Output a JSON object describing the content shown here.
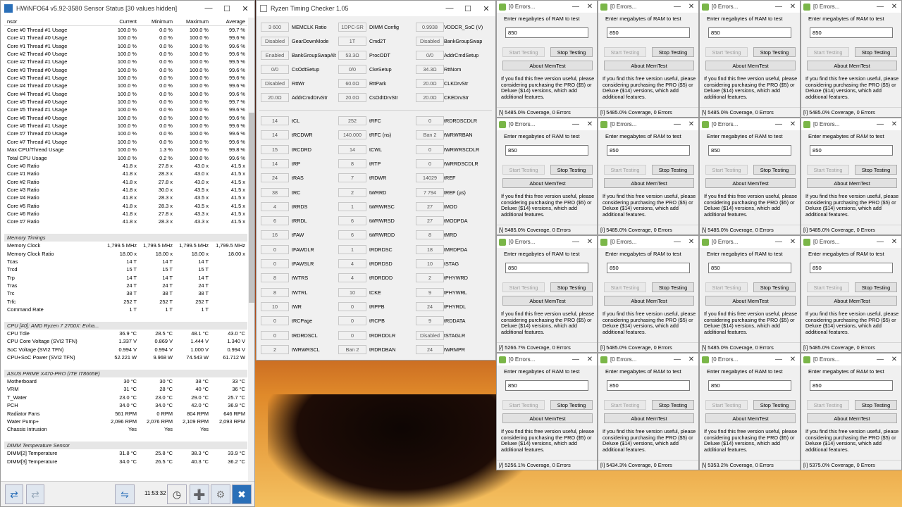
{
  "hwinfo": {
    "title": "HWiNFO64 v5.92-3580 Sensor Status [30 values hidden]",
    "columns": [
      "nsor",
      "Current",
      "Minimum",
      "Maximum",
      "Average"
    ],
    "rows": [
      [
        "Core #0 Thread #1 Usage",
        "100.0 %",
        "0.0 %",
        "100.0 %",
        "99.7 %"
      ],
      [
        "Core #1 Thread #0 Usage",
        "100.0 %",
        "0.0 %",
        "100.0 %",
        "99.6 %"
      ],
      [
        "Core #1 Thread #1 Usage",
        "100.0 %",
        "0.0 %",
        "100.0 %",
        "99.6 %"
      ],
      [
        "Core #2 Thread #0 Usage",
        "100.0 %",
        "0.0 %",
        "100.0 %",
        "99.6 %"
      ],
      [
        "Core #2 Thread #1 Usage",
        "100.0 %",
        "0.0 %",
        "100.0 %",
        "99.5 %"
      ],
      [
        "Core #3 Thread #0 Usage",
        "100.0 %",
        "0.0 %",
        "100.0 %",
        "99.6 %"
      ],
      [
        "Core #3 Thread #1 Usage",
        "100.0 %",
        "0.0 %",
        "100.0 %",
        "99.6 %"
      ],
      [
        "Core #4 Thread #0 Usage",
        "100.0 %",
        "0.0 %",
        "100.0 %",
        "99.6 %"
      ],
      [
        "Core #4 Thread #1 Usage",
        "100.0 %",
        "0.0 %",
        "100.0 %",
        "99.6 %"
      ],
      [
        "Core #5 Thread #0 Usage",
        "100.0 %",
        "0.0 %",
        "100.0 %",
        "99.7 %"
      ],
      [
        "Core #5 Thread #1 Usage",
        "100.0 %",
        "0.0 %",
        "100.0 %",
        "99.6 %"
      ],
      [
        "Core #6 Thread #0 Usage",
        "100.0 %",
        "0.0 %",
        "100.0 %",
        "99.6 %"
      ],
      [
        "Core #6 Thread #1 Usage",
        "100.0 %",
        "0.0 %",
        "100.0 %",
        "99.6 %"
      ],
      [
        "Core #7 Thread #0 Usage",
        "100.0 %",
        "0.0 %",
        "100.0 %",
        "99.6 %"
      ],
      [
        "Core #7 Thread #1 Usage",
        "100.0 %",
        "0.0 %",
        "100.0 %",
        "99.6 %"
      ],
      [
        "Max CPU/Thread Usage",
        "100.0 %",
        "1.3 %",
        "100.0 %",
        "99.8 %"
      ],
      [
        "Total CPU Usage",
        "100.0 %",
        "0.2 %",
        "100.0 %",
        "99.6 %"
      ],
      [
        "Core #0 Ratio",
        "41.8 x",
        "27.8 x",
        "43.0 x",
        "41.5 x"
      ],
      [
        "Core #1 Ratio",
        "41.8 x",
        "28.3 x",
        "43.0 x",
        "41.5 x"
      ],
      [
        "Core #2 Ratio",
        "41.8 x",
        "27.8 x",
        "43.0 x",
        "41.5 x"
      ],
      [
        "Core #3 Ratio",
        "41.8 x",
        "30.0 x",
        "43.5 x",
        "41.5 x"
      ],
      [
        "Core #4 Ratio",
        "41.8 x",
        "28.3 x",
        "43.5 x",
        "41.5 x"
      ],
      [
        "Core #5 Ratio",
        "41.8 x",
        "28.3 x",
        "43.5 x",
        "41.5 x"
      ],
      [
        "Core #6 Ratio",
        "41.8 x",
        "27.8 x",
        "43.3 x",
        "41.5 x"
      ],
      [
        "Core #7 Ratio",
        "41.8 x",
        "28.3 x",
        "43.3 x",
        "41.5 x"
      ],
      {
        "blank": true
      },
      {
        "section": "Memory Timings"
      },
      [
        "Memory Clock",
        "1,799.5 MHz",
        "1,799.5 MHz",
        "1,799.5 MHz",
        "1,799.5 MHz"
      ],
      [
        "Memory Clock Ratio",
        "18.00 x",
        "18.00 x",
        "18.00 x",
        "18.00 x"
      ],
      [
        "Tcas",
        "14 T",
        "14 T",
        "14 T",
        ""
      ],
      [
        "Trcd",
        "15 T",
        "15 T",
        "15 T",
        ""
      ],
      [
        "Trp",
        "14 T",
        "14 T",
        "14 T",
        ""
      ],
      [
        "Tras",
        "24 T",
        "24 T",
        "24 T",
        ""
      ],
      [
        "Trc",
        "38 T",
        "38 T",
        "38 T",
        ""
      ],
      [
        "Trfc",
        "252 T",
        "252 T",
        "252 T",
        ""
      ],
      [
        "Command Rate",
        "1 T",
        "1 T",
        "1 T",
        ""
      ],
      {
        "blank": true
      },
      {
        "section": "CPU [#0]: AMD Ryzen 7 2700X: Enha..."
      },
      [
        "CPU Tdie",
        "36.9 °C",
        "28.5 °C",
        "48.1 °C",
        "43.0 °C"
      ],
      [
        "CPU Core Voltage (SVI2 TFN)",
        "1.337 V",
        "0.869 V",
        "1.444 V",
        "1.340 V"
      ],
      [
        "SoC Voltage (SVI2 TFN)",
        "0.994 V",
        "0.994 V",
        "1.000 V",
        "0.994 V"
      ],
      [
        "CPU+SoC Power (SVI2 TFN)",
        "52.221 W",
        "9.968 W",
        "74.543 W",
        "61.712 W"
      ],
      {
        "blank": true
      },
      {
        "section": "ASUS PRIME X470-PRO (ITE IT8665E)"
      },
      [
        "Motherboard",
        "30 °C",
        "30 °C",
        "38 °C",
        "33 °C"
      ],
      [
        "VRM",
        "31 °C",
        "28 °C",
        "40 °C",
        "36 °C"
      ],
      [
        "T_Water",
        "23.0 °C",
        "23.0 °C",
        "29.0 °C",
        "25.7 °C"
      ],
      [
        "PCH",
        "34.0 °C",
        "34.0 °C",
        "42.0 °C",
        "36.9 °C"
      ],
      [
        "Radiator Fans",
        "561 RPM",
        "0 RPM",
        "804 RPM",
        "646 RPM"
      ],
      [
        "Water Pump+",
        "2,096 RPM",
        "2,076 RPM",
        "2,109 RPM",
        "2,093 RPM"
      ],
      [
        "Chassis Intrusion",
        "Yes",
        "Yes",
        "Yes",
        ""
      ],
      {
        "blank": true
      },
      {
        "section": "DIMM Temperature Sensor"
      },
      [
        "DIMM[2] Temperature",
        "31.8 °C",
        "25.8 °C",
        "38.3 °C",
        "33.9 °C"
      ],
      [
        "DIMM[3] Temperature",
        "34.0 °C",
        "26.5 °C",
        "40.3 °C",
        "36.2 °C"
      ]
    ],
    "time": "11:53:32"
  },
  "rtc": {
    "title": "Ryzen Timing Checker 1.05",
    "top": [
      [
        [
          "3 600",
          "MEMCLK Ratio"
        ],
        [
          "1DPC-SR",
          "DIMM Config"
        ],
        [
          "0.9938",
          "VDDCR_SoC (V)"
        ]
      ],
      [
        [
          "Disabled",
          "GearDownMode"
        ],
        [
          "1T",
          "Cmd2T"
        ],
        [
          "Disabled",
          "BankGroupSwap"
        ]
      ],
      [
        [
          "Enabled",
          "BankGroupSwapAlt"
        ],
        [
          "53.3Ω",
          "ProcODT"
        ],
        [
          "0/0",
          "AddrCmdSetup"
        ]
      ],
      [
        [
          "0/0",
          "CsOdtSetup"
        ],
        [
          "0/0",
          "CkeSetup"
        ],
        [
          "34.3Ω",
          "RttNom"
        ]
      ],
      [
        [
          "Disabled",
          "RttWr"
        ],
        [
          "60.0Ω",
          "RttPark"
        ],
        [
          "20.0Ω",
          "CLKDrvStr"
        ]
      ],
      [
        [
          "20.0Ω",
          "AddrCmdDrvStr"
        ],
        [
          "20.0Ω",
          "CsOdtDrvStr"
        ],
        [
          "20.0Ω",
          "CKEDrvStr"
        ]
      ]
    ],
    "timings": [
      [
        [
          "14",
          "tCL"
        ],
        [
          "252",
          "tRFC"
        ],
        [
          "0",
          "tRDRDSCDLR"
        ]
      ],
      [
        [
          "14",
          "tRCDWR"
        ],
        [
          "140.000",
          "tRFC (ns)"
        ],
        [
          "Ban 2",
          "tWRWRBAN"
        ]
      ],
      [
        [
          "15",
          "tRCDRD"
        ],
        [
          "14",
          "tCWL"
        ],
        [
          "0",
          "tWRWRSCDLR"
        ]
      ],
      [
        [
          "14",
          "tRP"
        ],
        [
          "8",
          "tRTP"
        ],
        [
          "0",
          "tWRRDSCDLR"
        ]
      ],
      [
        [
          "24",
          "tRAS"
        ],
        [
          "7",
          "tRDWR"
        ],
        [
          "14029",
          "tREF"
        ]
      ],
      [
        [
          "38",
          "tRC"
        ],
        [
          "2",
          "tWRRD"
        ],
        [
          "7 794",
          "tREF (µs)"
        ]
      ],
      [
        [
          "4",
          "tRRDS"
        ],
        [
          "1",
          "tWRWRSC"
        ],
        [
          "27",
          "tMOD"
        ]
      ],
      [
        [
          "6",
          "tRRDL"
        ],
        [
          "6",
          "tWRWRSD"
        ],
        [
          "27",
          "tMODPDA"
        ]
      ],
      [
        [
          "16",
          "tFAW"
        ],
        [
          "6",
          "tWRWRDD"
        ],
        [
          "8",
          "tMRD"
        ]
      ],
      [
        [
          "0",
          "tFAWDLR"
        ],
        [
          "1",
          "tRDRDSC"
        ],
        [
          "18",
          "tMRDPDA"
        ]
      ],
      [
        [
          "0",
          "tFAWSLR"
        ],
        [
          "4",
          "tRDRDSD"
        ],
        [
          "10",
          "tSTAG"
        ]
      ],
      [
        [
          "8",
          "tWTRS"
        ],
        [
          "4",
          "tRDRDDD"
        ],
        [
          "2",
          "tPHYWRD"
        ]
      ],
      [
        [
          "8",
          "tWTRL"
        ],
        [
          "10",
          "tCKE"
        ],
        [
          "9",
          "tPHYWRL"
        ]
      ],
      [
        [
          "10",
          "tWR"
        ],
        [
          "0",
          "tRPPB"
        ],
        [
          "24",
          "tPHYRDL"
        ]
      ],
      [
        [
          "0",
          "tRCPage"
        ],
        [
          "0",
          "tRCPB"
        ],
        [
          "9",
          "tRDDATA"
        ]
      ],
      [
        [
          "0",
          "tRDRDSCL"
        ],
        [
          "0",
          "tRDRDDLR"
        ],
        [
          "Disabled",
          "tSTAGLR"
        ]
      ],
      [
        [
          "2",
          "tWRWRSCL"
        ],
        [
          "Ban 2",
          "tRDRDBAN"
        ],
        [
          "24",
          "tWRMPR"
        ]
      ]
    ]
  },
  "memtest": {
    "title": "[0 Errors...",
    "prompt": "Enter megabytes of RAM to test",
    "value": "850",
    "start": "Start Testing",
    "stop": "Stop Testing",
    "about": "About MemTest",
    "info": "If you find this free version useful, please considering purchasing the PRO ($5) or Deluxe ($14) versions, which add additional features.",
    "statuses": [
      "[\\]  5485.0% Coverage, 0 Errors",
      "[\\]  5485.0% Coverage, 0 Errors",
      "[\\]  5485.0% Coverage, 0 Errors",
      "[\\]  5485.0% Coverage, 0 Errors",
      "[\\]  5485.0% Coverage, 0 Errors",
      "[/]  5485.0% Coverage, 0 Errors",
      "[\\]  5485.0% Coverage, 0 Errors",
      "[\\]  5485.0% Coverage, 0 Errors",
      "[/]  5266.7% Coverage, 0 Errors",
      "[\\]  5485.0% Coverage, 0 Errors",
      "[\\]  5485.0% Coverage, 0 Errors",
      "[\\]  5485.0% Coverage, 0 Errors",
      "[/]  5256.1% Coverage, 0 Errors",
      "[\\]  5434.3% Coverage, 0 Errors",
      "[\\]  5353.2% Coverage, 0 Errors",
      "[\\]  5375.0% Coverage, 0 Errors"
    ]
  },
  "colors": {
    "accent": "#2a6fb8",
    "memtest_icon": "#7ab648"
  }
}
